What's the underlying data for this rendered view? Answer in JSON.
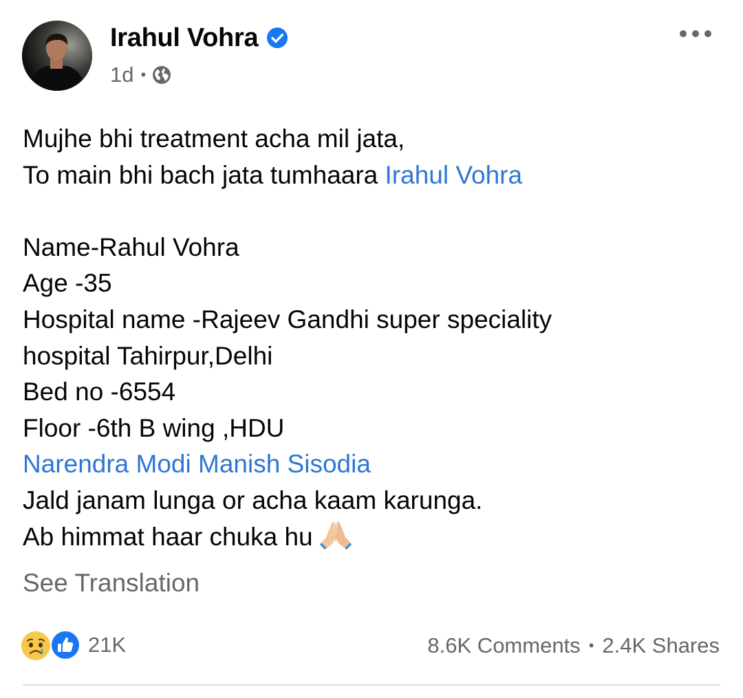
{
  "author": {
    "name": "Irahul Vohra",
    "verified": true,
    "time": "1d",
    "audience_icon": "globe-icon"
  },
  "post": {
    "lines": [
      "Mujhe bhi treatment acha mil jata,",
      "To main bhi bach jata tumhaara",
      "Name-Rahul Vohra",
      "Age -35",
      "Hospital name -Rajeev Gandhi super speciality",
      "hospital Tahirpur,Delhi",
      "Bed no -6554",
      "Floor -6th B wing ,HDU",
      "Jald janam lunga or acha kaam karunga.",
      "Ab himmat haar chuka hu"
    ],
    "mentions": {
      "line2": "Irahul Vohra",
      "tags": "Narendra Modi Manish Sisodia"
    },
    "emoji": "folded-hands-emoji",
    "see_translation": "See Translation"
  },
  "footer": {
    "reaction_icons": [
      "sad-face-icon",
      "like-icon"
    ],
    "reactions_count": "21K",
    "comments": "8.6K Comments",
    "shares": "2.4K Shares",
    "separator": "•"
  },
  "colors": {
    "link": "#2d76d6",
    "secondary_text": "#65676b",
    "verified": "#1877f2"
  }
}
